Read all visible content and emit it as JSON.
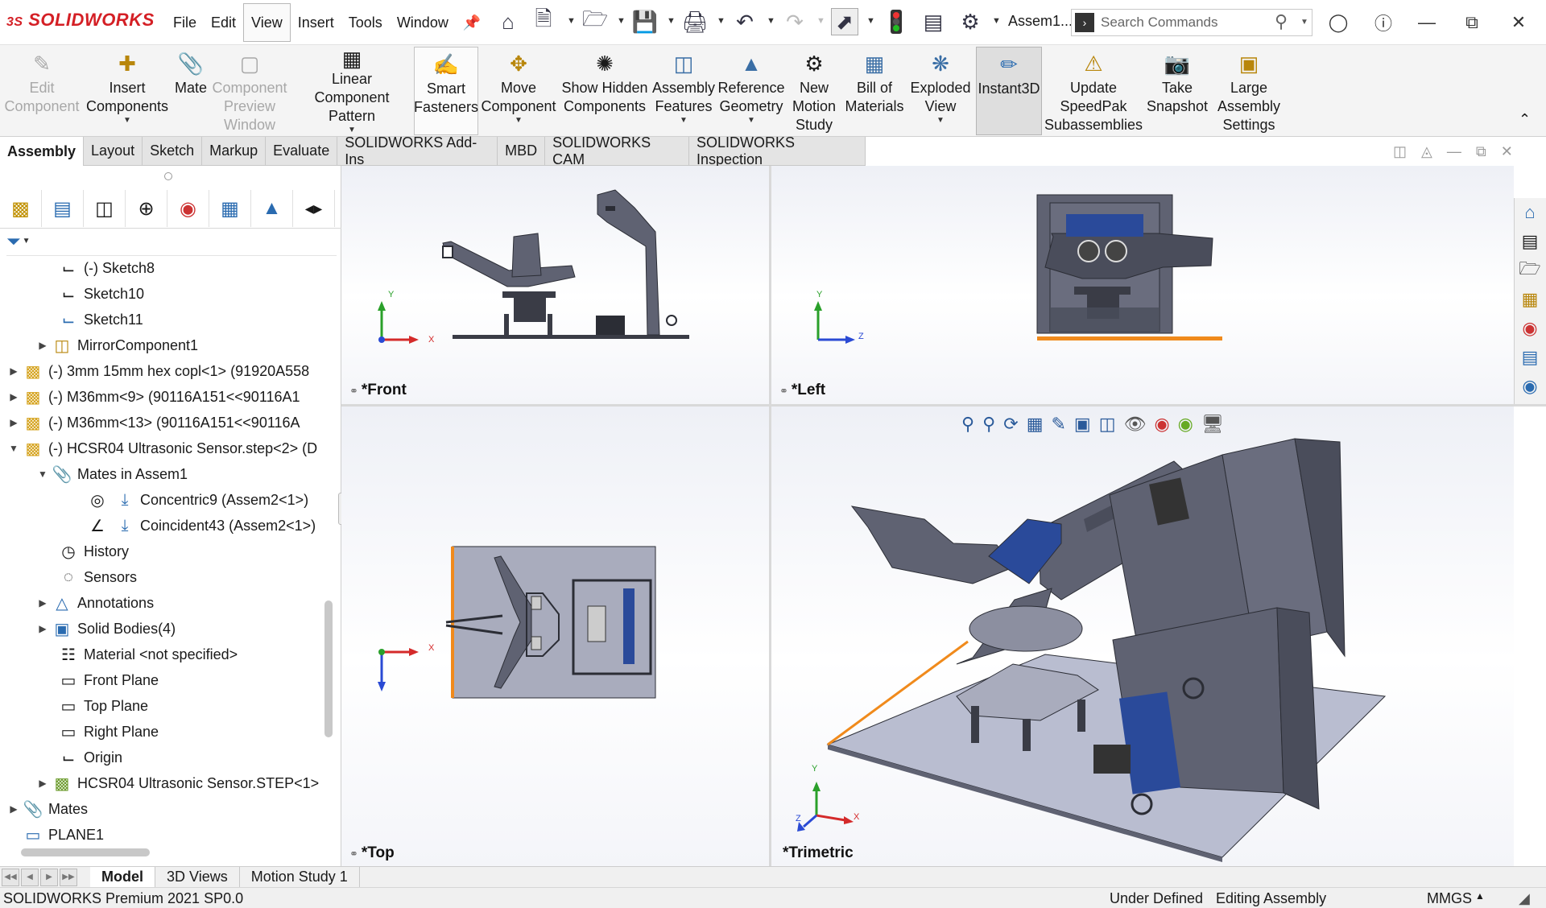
{
  "brand": {
    "logo_prefix": "3S",
    "logo_text": "SOLIDWORKS"
  },
  "menu": [
    "File",
    "Edit",
    "View",
    "Insert",
    "Tools",
    "Window"
  ],
  "active_menu": "View",
  "doc_title": "Assem1...",
  "search": {
    "placeholder": "Search Commands"
  },
  "commands": [
    {
      "label": "Edit Component",
      "icon": "edit-component-icon",
      "enabled": false
    },
    {
      "label": "Insert Components",
      "icon": "insert-components-icon",
      "enabled": true
    },
    {
      "label": "Mate",
      "icon": "mate-icon",
      "enabled": true
    },
    {
      "label": "Component Preview Window",
      "icon": "preview-window-icon",
      "enabled": false
    },
    {
      "label": "Linear Component Pattern",
      "icon": "linear-pattern-icon",
      "enabled": true
    },
    {
      "label": "Smart Fasteners",
      "icon": "smart-fasteners-icon",
      "enabled": true
    },
    {
      "label": "Move Component",
      "icon": "move-component-icon",
      "enabled": true
    },
    {
      "label": "Show Hidden Components",
      "icon": "show-hidden-icon",
      "enabled": true
    },
    {
      "label": "Assembly Features",
      "icon": "assembly-features-icon",
      "enabled": true
    },
    {
      "label": "Reference Geometry",
      "icon": "reference-geometry-icon",
      "enabled": true
    },
    {
      "label": "New Motion Study",
      "icon": "motion-study-icon",
      "enabled": true
    },
    {
      "label": "Bill of Materials",
      "icon": "bom-icon",
      "enabled": true
    },
    {
      "label": "Exploded View",
      "icon": "exploded-view-icon",
      "enabled": true
    },
    {
      "label": "Instant3D",
      "icon": "instant3d-icon",
      "enabled": true
    },
    {
      "label": "Update SpeedPak Subassemblies",
      "icon": "speedpak-icon",
      "enabled": true
    },
    {
      "label": "Take Snapshot",
      "icon": "snapshot-icon",
      "enabled": true
    },
    {
      "label": "Large Assembly Settings",
      "icon": "large-assembly-icon",
      "enabled": true
    }
  ],
  "tabs": [
    "Assembly",
    "Layout",
    "Sketch",
    "Markup",
    "Evaluate",
    "SOLIDWORKS Add-Ins",
    "MBD",
    "SOLIDWORKS CAM",
    "SOLIDWORKS Inspection"
  ],
  "tree": [
    {
      "label": "(-) Sketch8"
    },
    {
      "label": "Sketch10"
    },
    {
      "label": "Sketch11"
    },
    {
      "label": "MirrorComponent1"
    },
    {
      "label": "(-) 3mm 15mm hex copl<1> (91920A558"
    },
    {
      "label": "(-) M36mm<9> (90116A151<<90116A1"
    },
    {
      "label": "(-) M36mm<13> (90116A151<<90116A"
    },
    {
      "label": "(-) HCSR04 Ultrasonic Sensor.step<2> (D"
    },
    {
      "label": "Mates in Assem1"
    },
    {
      "label": "Concentric9 (Assem2<1>)"
    },
    {
      "label": "Coincident43 (Assem2<1>)"
    },
    {
      "label": "History"
    },
    {
      "label": "Sensors"
    },
    {
      "label": "Annotations"
    },
    {
      "label": "Solid Bodies(4)"
    },
    {
      "label": "Material <not specified>"
    },
    {
      "label": "Front Plane"
    },
    {
      "label": "Top Plane"
    },
    {
      "label": "Right Plane"
    },
    {
      "label": "Origin"
    },
    {
      "label": "HCSR04 Ultrasonic Sensor.STEP<1>"
    },
    {
      "label": "Mates"
    },
    {
      "label": "PLANE1"
    }
  ],
  "viewports": {
    "front": "*Front",
    "left": "*Left",
    "top": "*Top",
    "trimetric": "*Trimetric"
  },
  "axes": {
    "x": "X",
    "y": "Y",
    "z": "Z"
  },
  "bottom_tabs": [
    "Model",
    "3D Views",
    "Motion Study 1"
  ],
  "status": {
    "product": "SOLIDWORKS Premium 2021 SP0.0",
    "definition": "Under Defined",
    "mode": "Editing Assembly",
    "units": "MMGS"
  },
  "colors": {
    "brand_red": "#d41f25",
    "part_gray": "#5f6272",
    "plate": "#b9bdd0",
    "highlight_edge": "#f08a1c"
  }
}
